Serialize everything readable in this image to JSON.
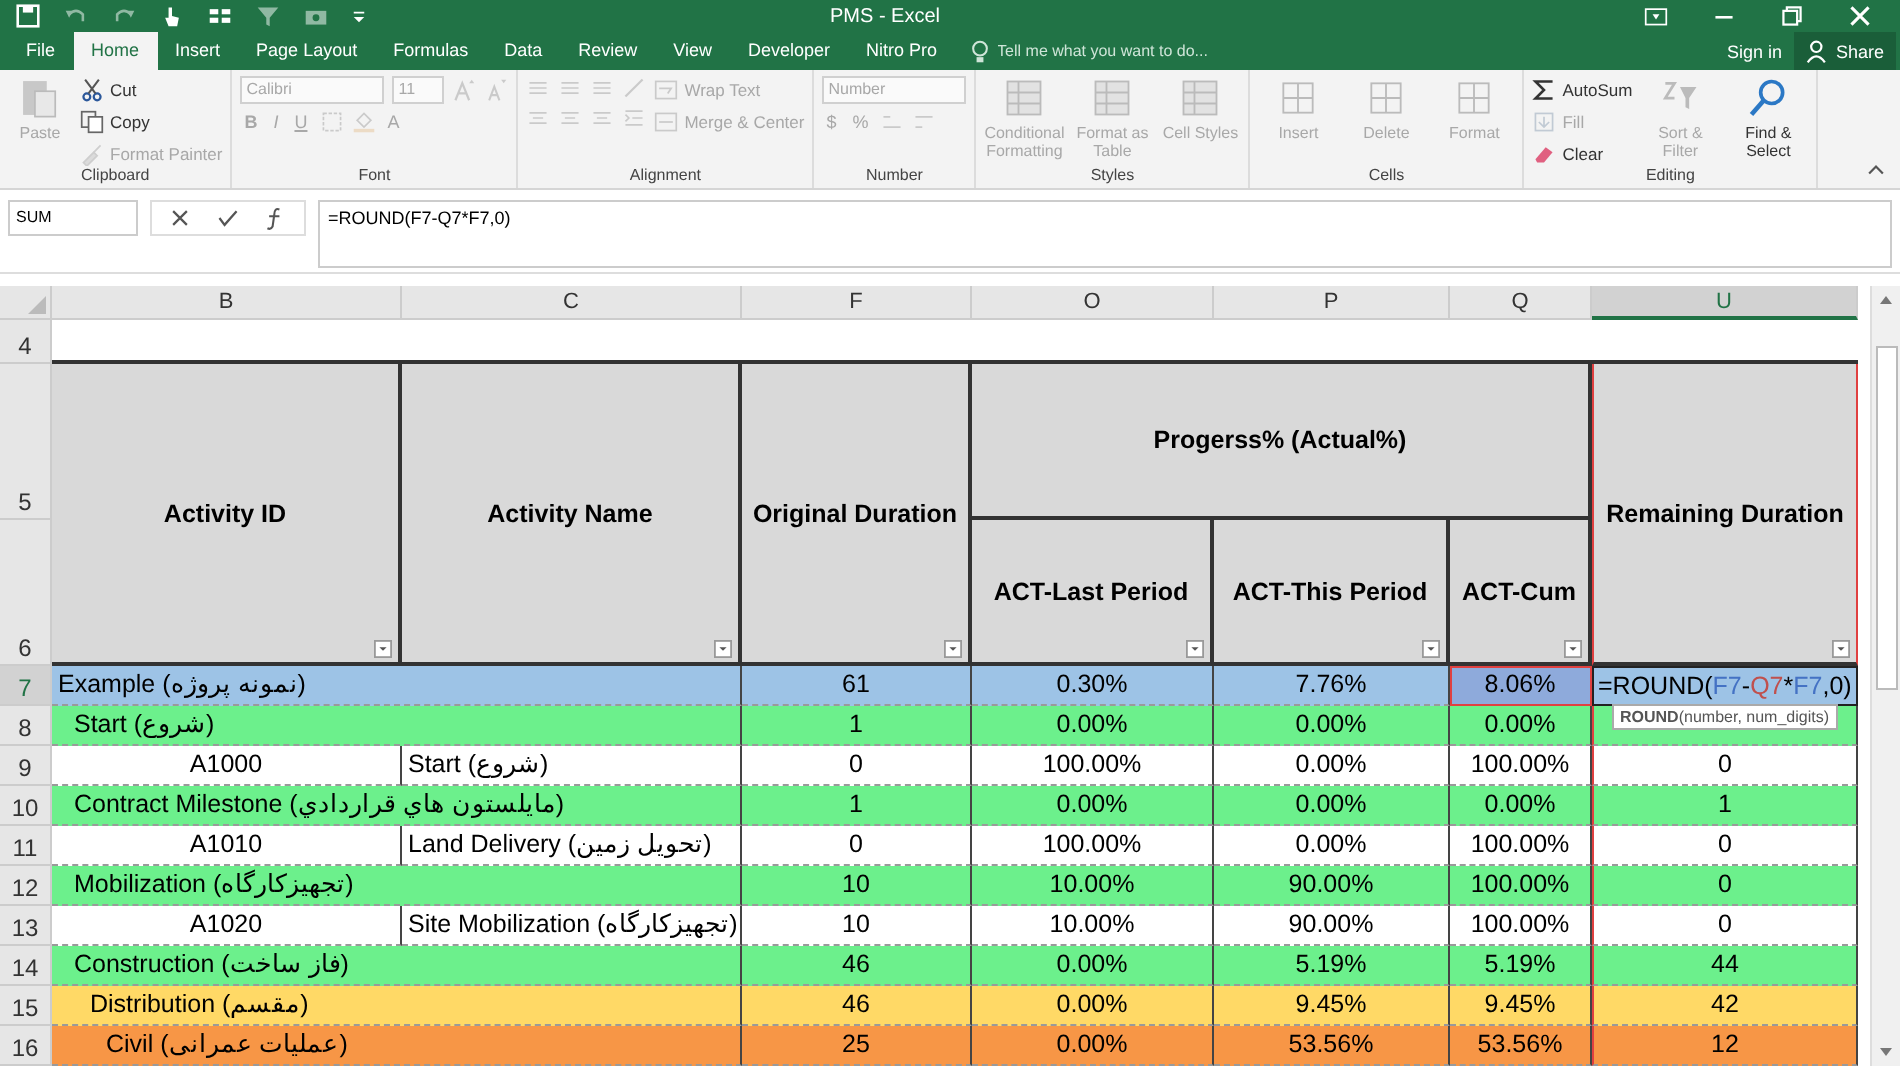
{
  "window": {
    "title": "PMS - Excel"
  },
  "tabs": [
    {
      "label": "File",
      "selected": false
    },
    {
      "label": "Home",
      "selected": true
    },
    {
      "label": "Insert",
      "selected": false
    },
    {
      "label": "Page Layout",
      "selected": false
    },
    {
      "label": "Formulas",
      "selected": false
    },
    {
      "label": "Data",
      "selected": false
    },
    {
      "label": "Review",
      "selected": false
    },
    {
      "label": "View",
      "selected": false
    },
    {
      "label": "Developer",
      "selected": false
    },
    {
      "label": "Nitro Pro",
      "selected": false
    }
  ],
  "tell_me": {
    "placeholder": "Tell me what you want to do..."
  },
  "account": {
    "sign_in": "Sign in",
    "share": "Share"
  },
  "ribbon": {
    "clipboard": {
      "label": "Clipboard",
      "paste": {
        "label": "Paste",
        "disabled": true
      },
      "cut": {
        "label": "Cut",
        "disabled": false
      },
      "copy": {
        "label": "Copy",
        "disabled": false
      },
      "format_painter": {
        "label": "Format Painter",
        "disabled": true
      }
    },
    "font": {
      "label": "Font",
      "family": "Calibri",
      "size": "11",
      "bold": "B",
      "italic": "I",
      "underline": "U",
      "color_letter": "A",
      "disabled": true
    },
    "alignment": {
      "label": "Alignment",
      "wrap_text": "Wrap Text",
      "merge": "Merge & Center",
      "disabled": true
    },
    "number": {
      "label": "Number",
      "format": "Number",
      "currency": "$",
      "percent": "%",
      "disabled": true
    },
    "styles": {
      "label": "Styles",
      "items": [
        {
          "label": "Conditional Formatting",
          "disabled": true
        },
        {
          "label": "Format as Table",
          "disabled": true
        },
        {
          "label": "Cell Styles",
          "disabled": true
        }
      ]
    },
    "cells": {
      "label": "Cells",
      "items": [
        {
          "label": "Insert",
          "disabled": true
        },
        {
          "label": "Delete",
          "disabled": true
        },
        {
          "label": "Format",
          "disabled": true
        }
      ]
    },
    "editing": {
      "label": "Editing",
      "autosum": {
        "label": "AutoSum",
        "disabled": false
      },
      "fill": {
        "label": "Fill",
        "disabled": true
      },
      "clear": {
        "label": "Clear",
        "disabled": false
      },
      "sort": {
        "label": "Sort & Filter",
        "disabled": true
      },
      "find": {
        "label": "Find & Select",
        "disabled": false
      }
    }
  },
  "formula_bar": {
    "name_box": "SUM",
    "formula": "=ROUND(F7-Q7*F7,0)"
  },
  "sheet": {
    "columns": [
      {
        "letter": "B",
        "selected": false
      },
      {
        "letter": "C",
        "selected": false
      },
      {
        "letter": "F",
        "selected": false
      },
      {
        "letter": "O",
        "selected": false
      },
      {
        "letter": "P",
        "selected": false
      },
      {
        "letter": "Q",
        "selected": false
      },
      {
        "letter": "U",
        "selected": true
      }
    ],
    "header_row_numbers": [
      "4",
      "5",
      "6"
    ],
    "headings": {
      "activity_id": "Activity ID",
      "activity_name": "Activity Name",
      "original_duration": "Original Duration",
      "progress": "Progerss% (Actual%)",
      "last_period": "ACT-Last Period",
      "this_period": "ACT-This Period",
      "cum": "ACT-Cum",
      "remaining": "Remaining Duration"
    },
    "rows": [
      {
        "number": "7",
        "selected": true,
        "kind": "wbs",
        "color": "#9dc3e6",
        "b": "Example (نمونه پروژه)",
        "f": "61",
        "o": "0.30%",
        "p": "7.76%",
        "q": "8.06%",
        "u_formula": [
          {
            "text": "=ROUND("
          },
          {
            "text": "F7",
            "color": "#4472c4"
          },
          {
            "text": "-"
          },
          {
            "text": "Q7",
            "color": "#c0504d"
          },
          {
            "text": "*"
          },
          {
            "text": "F7",
            "color": "#4472c4"
          },
          {
            "text": ",0)"
          }
        ],
        "children": [
          {
            "number": "8",
            "selected": false,
            "kind": "wbs",
            "color": "#6cf08c",
            "b": "Start (شروع)",
            "f": "1",
            "o": "0.00%",
            "p": "0.00%",
            "q": "0.00%",
            "children": [
              {
                "number": "9",
                "selected": false,
                "kind": "activity",
                "color": "#ffffff",
                "b": "A1000",
                "c": "Start (شروع)",
                "f": "0",
                "o": "100.00%",
                "p": "0.00%",
                "q": "100.00%",
                "u": "0"
              }
            ]
          },
          {
            "number": "10",
            "selected": false,
            "kind": "wbs",
            "color": "#6cf08c",
            "b": "Contract Milestone (مايلستون هاي قراردادي)",
            "f": "1",
            "o": "0.00%",
            "p": "0.00%",
            "q": "0.00%",
            "u": "1",
            "children": [
              {
                "number": "11",
                "selected": false,
                "kind": "activity",
                "color": "#ffffff",
                "b": "A1010",
                "c": "Land Delivery (تحویل زمین)",
                "f": "0",
                "o": "100.00%",
                "p": "0.00%",
                "q": "100.00%",
                "u": "0"
              }
            ]
          },
          {
            "number": "12",
            "selected": false,
            "kind": "wbs",
            "color": "#6cf08c",
            "b": "Mobilization (تجهیزکارگاه)",
            "f": "10",
            "o": "10.00%",
            "p": "90.00%",
            "q": "100.00%",
            "u": "0",
            "children": [
              {
                "number": "13",
                "selected": false,
                "kind": "activity",
                "color": "#ffffff",
                "b": "A1020",
                "c": "Site Mobilization (تجهیزکارگاه)",
                "f": "10",
                "o": "10.00%",
                "p": "90.00%",
                "q": "100.00%",
                "u": "0"
              }
            ]
          },
          {
            "number": "14",
            "selected": false,
            "kind": "wbs",
            "color": "#6cf08c",
            "b": "Construction (فاز ساخت)",
            "f": "46",
            "o": "0.00%",
            "p": "5.19%",
            "q": "5.19%",
            "u": "44",
            "children": [
              {
                "number": "15",
                "selected": false,
                "kind": "wbs",
                "color": "#ffd966",
                "b": "Distribution (مقسم)",
                "f": "46",
                "o": "0.00%",
                "p": "9.45%",
                "q": "9.45%",
                "u": "42",
                "children": [
                  {
                    "number": "16",
                    "selected": false,
                    "kind": "wbs",
                    "color": "#f79646",
                    "b": "Civil (عملیات عمرانی)",
                    "f": "25",
                    "o": "0.00%",
                    "p": "53.56%",
                    "q": "53.56%",
                    "u": "12"
                  }
                ]
              }
            ]
          }
        ]
      }
    ],
    "tooltip": "**ROUND**(number, num_digits)"
  }
}
